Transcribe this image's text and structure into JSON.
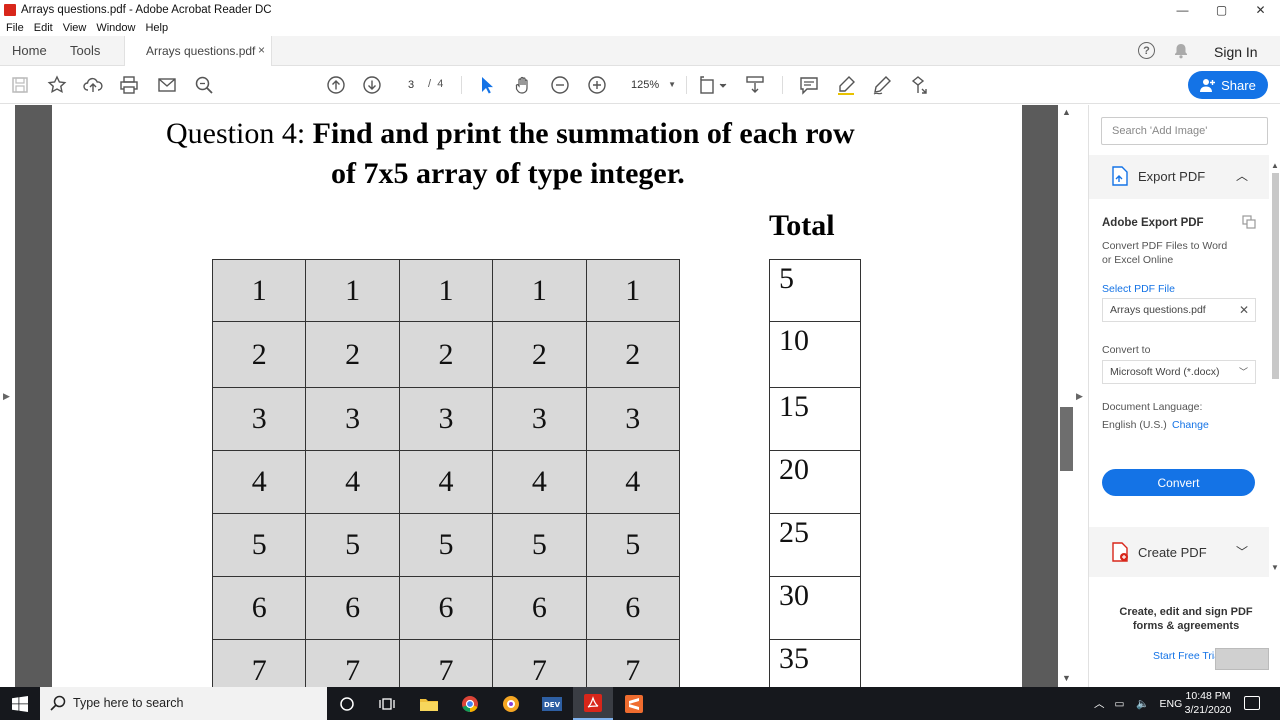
{
  "window": {
    "title": "Arrays questions.pdf - Adobe Acrobat Reader DC",
    "minimize_glyph": "—",
    "maximize_glyph": "▢",
    "close_glyph": "✕"
  },
  "menubar": [
    "File",
    "Edit",
    "View",
    "Window",
    "Help"
  ],
  "tabs": {
    "home": "Home",
    "tools": "Tools",
    "document": "Arrays questions.pdf",
    "close_glyph": "×"
  },
  "header_right": {
    "help_glyph": "?",
    "sign_in": "Sign In"
  },
  "toolbar": {
    "current_page": "3",
    "page_separator": "/",
    "total_pages": "4",
    "zoom": "125%",
    "zoom_caret": "▼",
    "share_label": "Share"
  },
  "document": {
    "question_prefix": "Question 4: ",
    "question_bold": "Find and print the summation of each row",
    "question_line2": "of 7x5 array of type integer.",
    "total_label": "Total",
    "grid": [
      [
        "1",
        "1",
        "1",
        "1",
        "1"
      ],
      [
        "2",
        "2",
        "2",
        "2",
        "2"
      ],
      [
        "3",
        "3",
        "3",
        "3",
        "3"
      ],
      [
        "4",
        "4",
        "4",
        "4",
        "4"
      ],
      [
        "5",
        "5",
        "5",
        "5",
        "5"
      ],
      [
        "6",
        "6",
        "6",
        "6",
        "6"
      ],
      [
        "7",
        "7",
        "7",
        "7",
        "7"
      ]
    ],
    "totals": [
      "5",
      "10",
      "15",
      "20",
      "25",
      "30",
      "35"
    ]
  },
  "right_panel": {
    "search_placeholder": "Search 'Add Image'",
    "export_title": "Export PDF",
    "adobe_export_title": "Adobe Export PDF",
    "description": "Convert PDF Files to Word or Excel Online",
    "select_file_label": "Select PDF File",
    "selected_file": "Arrays questions.pdf",
    "convert_to_label": "Convert to",
    "convert_format": "Microsoft Word (*.docx)",
    "doc_language_label": "Document Language:",
    "doc_language": "English (U.S.)",
    "change_link": "Change",
    "convert_button": "Convert",
    "create_title": "Create PDF",
    "promo": "Create, edit and sign PDF forms & agreements",
    "trial_link": "Start Free Trial"
  },
  "taskbar": {
    "search_placeholder": "Type here to search",
    "language": "ENG",
    "time": "10:48 PM",
    "date": "3/21/2020"
  },
  "colors": {
    "accent": "#1473e6",
    "acrobat_red": "#d8261a",
    "doc_background": "#5b5b5b",
    "grid_fill": "#d9d9d9",
    "taskbar": "#16181d"
  }
}
